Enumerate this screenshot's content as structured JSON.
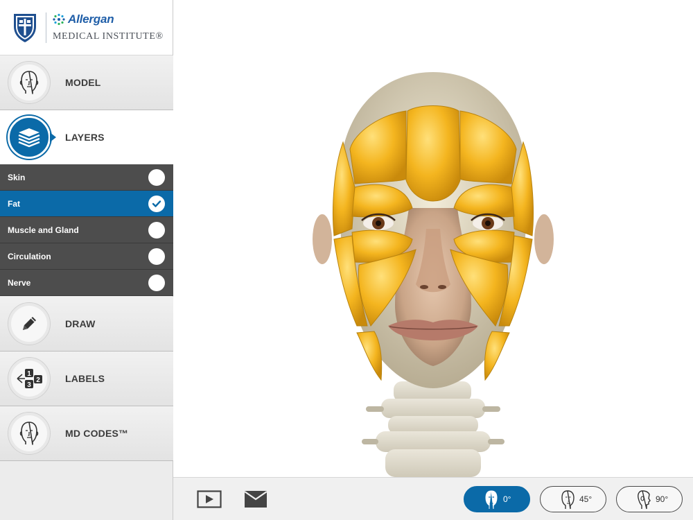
{
  "brand": {
    "name": "Allergan",
    "subtitle": "MEDICAL INSTITUTE®",
    "accent": "#1f5ea8"
  },
  "nav": {
    "model": {
      "label": "MODEL",
      "icon": "head-front-icon"
    },
    "layers": {
      "label": "LAYERS",
      "icon": "layers-icon",
      "active": true
    },
    "draw": {
      "label": "DRAW",
      "icon": "pencil-icon"
    },
    "labels": {
      "label": "LABELS",
      "icon": "numbered-labels-icon"
    },
    "mdcodes": {
      "label": "MD CODES™",
      "icon": "head-front-icon"
    }
  },
  "layers": [
    {
      "label": "Skin",
      "checked": false
    },
    {
      "label": "Fat",
      "checked": true
    },
    {
      "label": "Muscle and Gland",
      "checked": false
    },
    {
      "label": "Circulation",
      "checked": false
    },
    {
      "label": "Nerve",
      "checked": false
    }
  ],
  "toolbar": {
    "play_icon": "play-icon",
    "mail_icon": "mail-icon",
    "views": [
      {
        "label": "0°",
        "active": true
      },
      {
        "label": "45°",
        "active": false
      },
      {
        "label": "90°",
        "active": false
      }
    ]
  },
  "colors": {
    "primary": "#0b6aa8",
    "layer_row": "#4d4d4d",
    "fat": "#f2b41e"
  }
}
